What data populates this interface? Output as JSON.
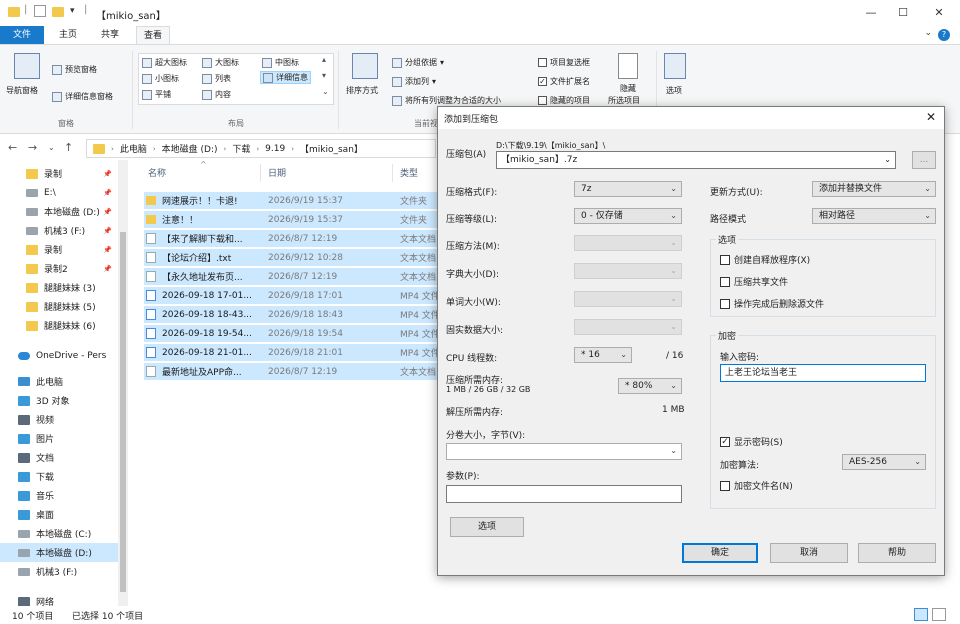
{
  "window": {
    "title": "【mikio_san】",
    "controls": {
      "minimize": "—",
      "maximize": "☐",
      "close": "✕"
    }
  },
  "ribbon_tabs": {
    "file": "文件",
    "home": "主页",
    "share": "共享",
    "view": "查看"
  },
  "ribbon": {
    "pane": {
      "nav_pane": "导航窗格",
      "preview_pane": "预览窗格",
      "details_pane": "详细信息窗格",
      "group_label": "窗格"
    },
    "layout": {
      "extra_large": "超大图标",
      "large": "大图标",
      "medium": "中图标",
      "small": "小图标",
      "list": "列表",
      "details": "详细信息",
      "tiles": "平铺",
      "content": "内容",
      "group_label": "布局"
    },
    "current_view": {
      "sort_by": "排序方式",
      "group_by": "分组依据",
      "add_columns": "添加列",
      "fit_columns": "将所有列调整为合适的大小",
      "group_label": "当前视图"
    },
    "show_hide": {
      "item_checkboxes": "项目复选框",
      "file_ext": "文件扩展名",
      "hidden_items": "隐藏的项目",
      "hide_selected": "隐藏",
      "hide_selected_2": "所选项目"
    },
    "options": "选项"
  },
  "address": {
    "crumbs": [
      "此电脑",
      "本地磁盘 (D:)",
      "下载",
      "9.19",
      "【mikio_san】"
    ]
  },
  "sidebar": {
    "items": [
      {
        "label": "录制",
        "icon": "folder",
        "pinned": true
      },
      {
        "label": "E:\\",
        "icon": "drive",
        "pinned": true
      },
      {
        "label": "本地磁盘 (D:)",
        "icon": "drive",
        "pinned": true
      },
      {
        "label": "机械3 (F:)",
        "icon": "drive",
        "pinned": true
      },
      {
        "label": "录制",
        "icon": "folder",
        "pinned": true
      },
      {
        "label": "录制2",
        "icon": "folder",
        "pinned": true
      },
      {
        "label": "腿腿妹妹 (3)",
        "icon": "folder",
        "pinned": false
      },
      {
        "label": "腿腿妹妹 (5)",
        "icon": "folder",
        "pinned": false
      },
      {
        "label": "腿腿妹妹 (6)",
        "icon": "folder",
        "pinned": false
      },
      {
        "label": "OneDrive - Pers",
        "icon": "cloud",
        "pinned": false
      },
      {
        "label": "此电脑",
        "icon": "pc",
        "pinned": false
      },
      {
        "label": "3D 对象",
        "icon": "blue",
        "pinned": false
      },
      {
        "label": "视频",
        "icon": "dark",
        "pinned": false
      },
      {
        "label": "图片",
        "icon": "blue",
        "pinned": false
      },
      {
        "label": "文档",
        "icon": "dark",
        "pinned": false
      },
      {
        "label": "下载",
        "icon": "blue",
        "pinned": false
      },
      {
        "label": "音乐",
        "icon": "blue",
        "pinned": false
      },
      {
        "label": "桌面",
        "icon": "blue",
        "pinned": false
      },
      {
        "label": "本地磁盘 (C:)",
        "icon": "drive",
        "pinned": false
      },
      {
        "label": "本地磁盘 (D:)",
        "icon": "drive",
        "pinned": false
      },
      {
        "label": "机械3 (F:)",
        "icon": "drive",
        "pinned": false
      },
      {
        "label": "网络",
        "icon": "dark",
        "pinned": false
      }
    ]
  },
  "filelist": {
    "columns": {
      "name": "名称",
      "date": "日期",
      "type": "类型"
    },
    "rows": [
      {
        "name": "网速展示！！卡退!",
        "date": "2026/9/19 15:37",
        "type": "文件夹",
        "kind": "folder"
      },
      {
        "name": "注意！！",
        "date": "2026/9/19 15:37",
        "type": "文件夹",
        "kind": "folder"
      },
      {
        "name": "【来了解脚下载和...",
        "date": "2026/8/7 12:19",
        "type": "文本文档",
        "kind": "txt"
      },
      {
        "name": "【论坛介绍】.txt",
        "date": "2026/9/12 10:28",
        "type": "文本文档",
        "kind": "txt"
      },
      {
        "name": "【永久地址发布页...",
        "date": "2026/8/7 12:19",
        "type": "文本文档",
        "kind": "txt"
      },
      {
        "name": "2026-09-18 17-01...",
        "date": "2026/9/18 17:01",
        "type": "MP4 文件",
        "kind": "mp4"
      },
      {
        "name": "2026-09-18 18-43...",
        "date": "2026/9/18 18:43",
        "type": "MP4 文件",
        "kind": "mp4"
      },
      {
        "name": "2026-09-18 19-54...",
        "date": "2026/9/18 19:54",
        "type": "MP4 文件",
        "kind": "mp4"
      },
      {
        "name": "2026-09-18 21-01...",
        "date": "2026/9/18 21:01",
        "type": "MP4 文件",
        "kind": "mp4"
      },
      {
        "name": "最新地址及APP命...",
        "date": "2026/8/7 12:19",
        "type": "文本文档",
        "kind": "txt"
      }
    ]
  },
  "statusbar": {
    "count": "10 个项目",
    "selected": "已选择 10 个项目"
  },
  "dialog": {
    "title": "添加到压缩包",
    "archive_label": "压缩包(A)",
    "archive_path": "D:\\下载\\9.19\\【mikio_san】\\",
    "archive_name": "【mikio_san】.7z",
    "browse": "...",
    "format_label": "压缩格式(F):",
    "format_value": "7z",
    "level_label": "压缩等级(L):",
    "level_value": "0 - 仅存储",
    "method_label": "压缩方法(M):",
    "dict_label": "字典大小(D):",
    "word_label": "单词大小(W):",
    "solid_label": "固实数据大小:",
    "threads_label": "CPU 线程数:",
    "threads_value": "* 16",
    "threads_max": "/ 16",
    "mem_label": "压缩所需内存:",
    "mem_detail": "1 MB / 26 GB / 32 GB",
    "mem_value": "* 80%",
    "decomp_label": "解压所需内存:",
    "decomp_value": "1 MB",
    "split_label": "分卷大小，字节(V):",
    "params_label": "参数(P):",
    "options_btn": "选项",
    "update_label": "更新方式(U):",
    "update_value": "添加并替换文件",
    "path_label": "路径模式",
    "path_value": "相对路径",
    "options_group": "选项",
    "opt_sfx": "创建自释放程序(X)",
    "opt_shared": "压缩共享文件",
    "opt_delete": "操作完成后删除源文件",
    "enc_group": "加密",
    "pw_label": "输入密码:",
    "pw_value": "上老王论坛当老王",
    "show_pw": "显示密码(S)",
    "enc_method_label": "加密算法:",
    "enc_method_value": "AES-256",
    "enc_names": "加密文件名(N)",
    "ok": "确定",
    "cancel": "取消",
    "help": "帮助"
  }
}
